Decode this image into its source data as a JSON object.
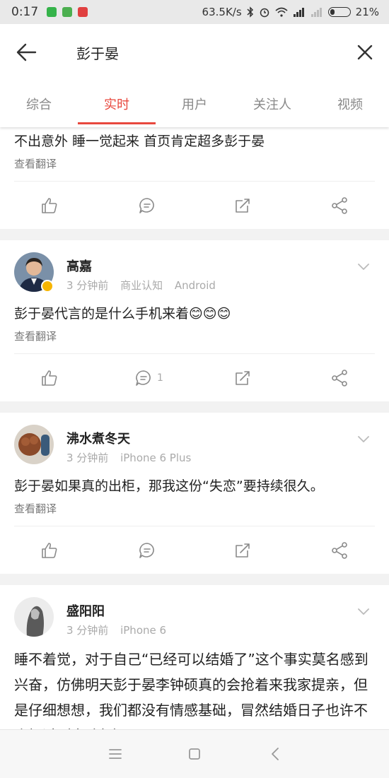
{
  "status_bar": {
    "time": "0:17",
    "network_speed": "63.5K/s",
    "battery": "21%",
    "battery_level": 0.21
  },
  "search": {
    "query": "彭于晏"
  },
  "tabs": [
    {
      "label": "综合"
    },
    {
      "label": "实时",
      "active": true
    },
    {
      "label": "用户"
    },
    {
      "label": "关注人"
    },
    {
      "label": "视频"
    }
  ],
  "posts": [
    {
      "content": "不出意外 睡一觉起来 首页肯定超多彭于晏",
      "translate": "查看翻译"
    },
    {
      "user": "高嘉",
      "time": "3 分钟前",
      "source_label": "商业认知",
      "device": "Android",
      "content": "彭于晏代言的是什么手机来着😊😊😊",
      "translate": "查看翻译",
      "comments": "1"
    },
    {
      "user": "沸水煮冬天",
      "time": "3 分钟前",
      "device": "iPhone 6 Plus",
      "content": "彭于晏如果真的出柜，那我这份“失恋”要持续很久。",
      "translate": "查看翻译"
    },
    {
      "user": "盛阳阳",
      "time": "3 分钟前",
      "device": "iPhone 6",
      "content": "睡不着觉，对于自己“已经可以结婚了”这个事实莫名感到兴奋，仿佛明天彭于晏李钟硕真的会抢着来我家提亲，但是仔细想想，我们都没有情感基础，冒然结婚日子也许不会好过（真敢想）"
    }
  ],
  "colors": {
    "accent": "#e8483e",
    "icon": "#8a8a8a"
  }
}
